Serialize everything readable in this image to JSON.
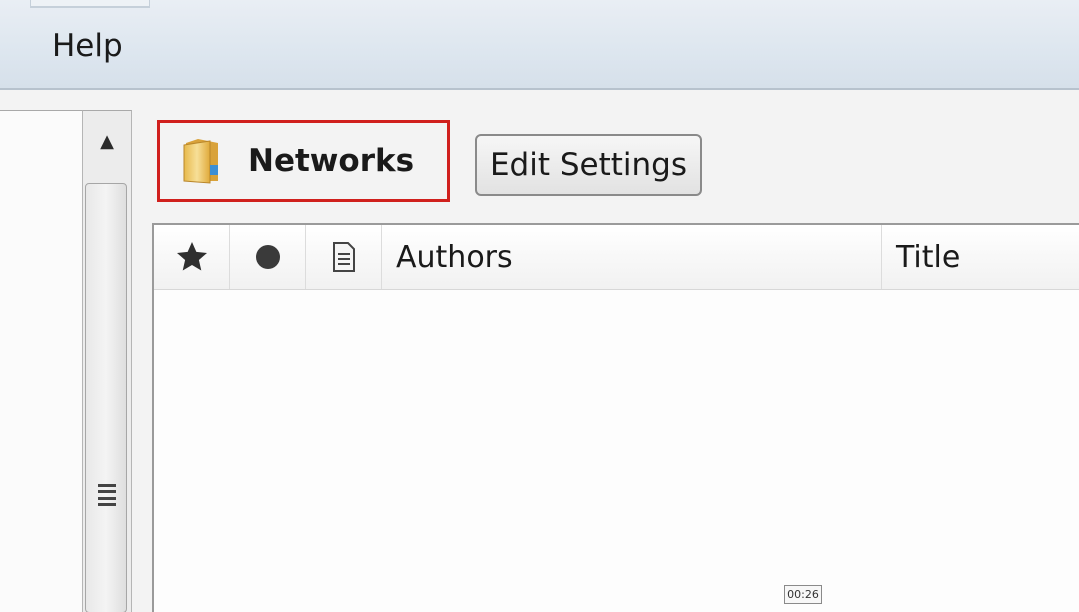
{
  "menubar": {
    "items": [
      {
        "label": "Help"
      }
    ]
  },
  "toolbar": {
    "folder": {
      "label": "Networks",
      "icon": "folder-icon"
    },
    "edit_settings_label": "Edit Settings"
  },
  "table": {
    "columns": [
      {
        "type": "icon",
        "icon": "star-icon"
      },
      {
        "type": "icon",
        "icon": "dot-icon"
      },
      {
        "type": "icon",
        "icon": "document-icon"
      },
      {
        "type": "text",
        "label": "Authors"
      },
      {
        "type": "text",
        "label": "Title"
      }
    ],
    "rows": []
  },
  "status": {
    "time": "00:26"
  },
  "colors": {
    "highlight_border": "#d0201d",
    "menubar": "#dde6ef"
  }
}
